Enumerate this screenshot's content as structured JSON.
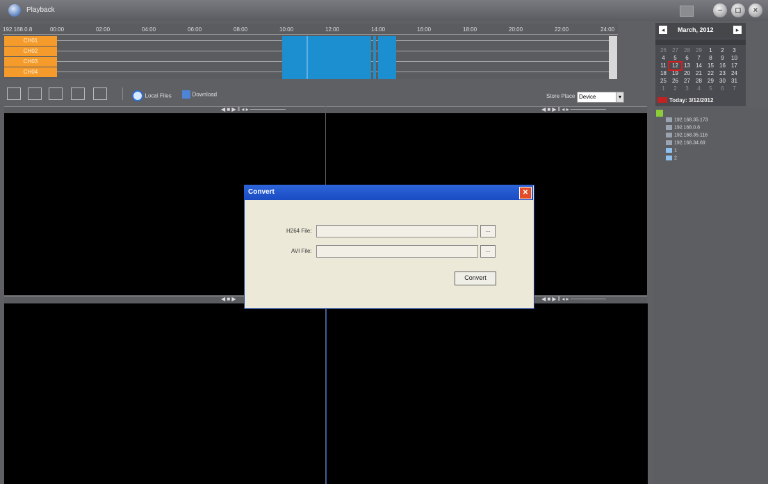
{
  "app": {
    "title": "Playback"
  },
  "timeline": {
    "ip": "192.168.0.8",
    "ticks": [
      "00:00",
      "02:00",
      "04:00",
      "06:00",
      "08:00",
      "10:00",
      "12:00",
      "14:00",
      "16:00",
      "18:00",
      "20:00",
      "22:00",
      "24:00"
    ],
    "channels": [
      "CH01",
      "CH02",
      "CH03",
      "CH04"
    ]
  },
  "toolbar": {
    "local_files": "Local Files",
    "download": "Download",
    "store_place_label": "Store Place",
    "store_place_value": "Device"
  },
  "calendar": {
    "title": "March, 2012",
    "days": [
      [
        "26",
        "27",
        "28",
        "29",
        "1",
        "2",
        "3"
      ],
      [
        "4",
        "5",
        "6",
        "7",
        "8",
        "9",
        "10"
      ],
      [
        "11",
        "12",
        "13",
        "14",
        "15",
        "16",
        "17"
      ],
      [
        "18",
        "19",
        "20",
        "21",
        "22",
        "23",
        "24"
      ],
      [
        "25",
        "26",
        "27",
        "28",
        "29",
        "30",
        "31"
      ],
      [
        "1",
        "2",
        "3",
        "4",
        "5",
        "6",
        "7"
      ]
    ],
    "today": "Today: 3/12/2012"
  },
  "tree": {
    "items": [
      "192.168.35.173",
      "192.168.0.8",
      "192.168.35.116",
      "192.168.34.69",
      "1",
      "2"
    ]
  },
  "dialog": {
    "title": "Convert",
    "h264_label": "H264 File:",
    "avi_label": "AVI File:",
    "browse": "...",
    "convert": "Convert"
  }
}
